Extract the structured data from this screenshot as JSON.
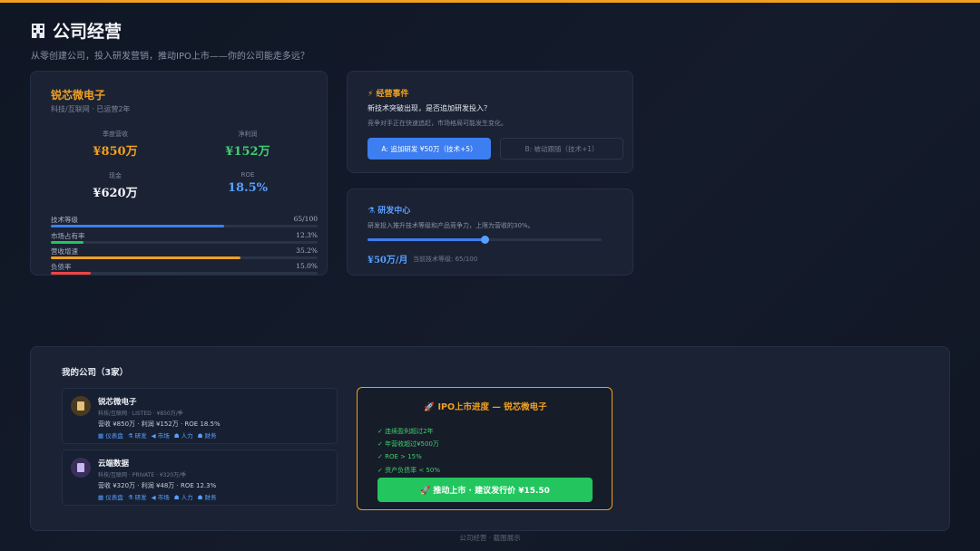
{
  "header": {
    "title": "公司经营",
    "subtitle": "从零创建公司，投入研发营销，推动IPO上市——你的公司能走多远？"
  },
  "company": {
    "name": "锐芯微电子",
    "meta": "科技/互联网 · 已运营2年",
    "stats": [
      {
        "label": "季度营收",
        "value": "¥850万",
        "color": "#f0a020"
      },
      {
        "label": "净利润",
        "value": "¥152万",
        "color": "#3fcf70"
      },
      {
        "label": "现金",
        "value": "¥620万",
        "color": "#f2f4f8"
      },
      {
        "label": "ROE",
        "value": "18.5%",
        "color": "#58a0ff"
      }
    ],
    "bars": [
      {
        "label": "技术等级",
        "value": "65/100",
        "pct": 0.65,
        "color": "#3d7ef0"
      },
      {
        "label": "市场占有率",
        "value": "12.3%",
        "pct": 0.123,
        "color": "#22c55e"
      },
      {
        "label": "营收增速",
        "value": "35.2%",
        "pct": 0.71,
        "color": "#f0a020"
      },
      {
        "label": "负债率",
        "value": "15.0%",
        "pct": 0.15,
        "color": "#ef4444"
      }
    ]
  },
  "event": {
    "title": "⚡ 经营事件",
    "question": "新技术突破出现，是否追加研发投入？",
    "desc": "竞争对手正在快速追赶，市场格局可能发生变化。",
    "option_a": "A: 追加研发 ¥50万（技术+5）",
    "option_b": "B: 被动跟随（技术+1）"
  },
  "rd": {
    "title": "研发中心",
    "desc": "研发投入推升技术等级和产品竞争力，上限为营收的30%。",
    "level_fraction": 0.5,
    "amount": "¥50万/月",
    "tech_level": "当前技术等级: 65/100"
  },
  "my_companies": {
    "title": "我的公司（3家）",
    "items": [
      {
        "name": "锐芯微电子",
        "meta": "科技/互联网 · LISTED · ¥850万/季",
        "finance": "营收 ¥850万 · 利润 ¥152万 · ROE 18.5%",
        "avatar_color": "#4a3a22",
        "avatar_icon_color": "#e5c27a",
        "actions": [
          "▦ 仪表盘",
          "⚗ 研发",
          "◀ 市场",
          "☗ 人力",
          "☗ 财务"
        ]
      },
      {
        "name": "云端数据",
        "meta": "科技/互联网 · PRIVATE · ¥320万/季",
        "finance": "营收 ¥320万 · 利润 ¥48万 · ROE 12.3%",
        "avatar_color": "#3a2f5a",
        "avatar_icon_color": "#c8b8f0",
        "actions": [
          "▦ 仪表盘",
          "⚗ 研发",
          "◀ 市场",
          "☗ 人力",
          "☗ 财务"
        ]
      }
    ]
  },
  "ipo": {
    "title": "🚀 IPO上市进度 — 锐芯微电子",
    "conditions": [
      "✓ 连续盈利超过2年",
      "✓ 年营收超过¥500万",
      "✓ ROE > 15%",
      "✓ 资产负债率 < 50%"
    ],
    "button": "🚀 推动上市 · 建议发行价 ¥15.50"
  },
  "footer": "公司经营 · 截图展示"
}
